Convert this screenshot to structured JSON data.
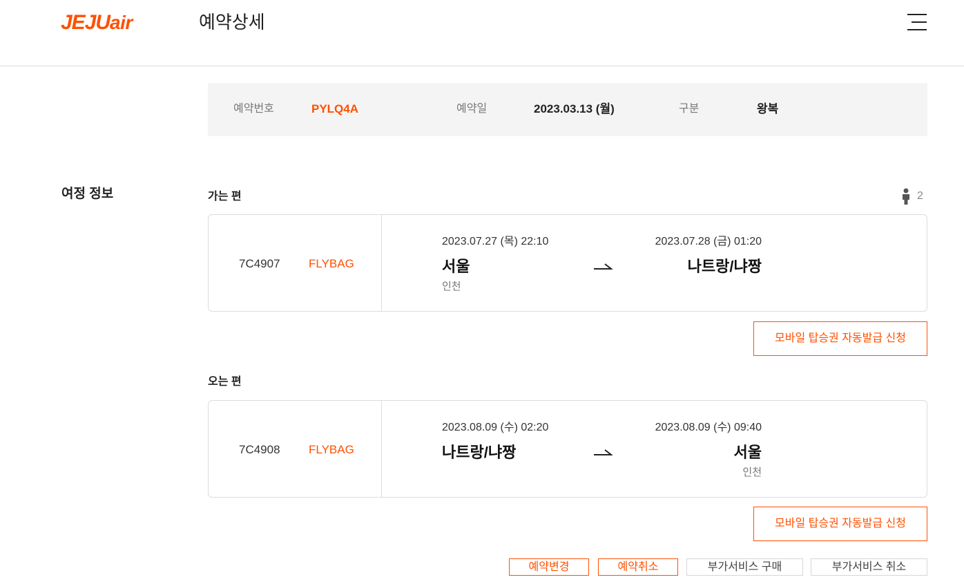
{
  "header": {
    "logo_main": "JEJU",
    "logo_suffix": "air",
    "title": "예약상세"
  },
  "summary": {
    "booking_no_label": "예약번호",
    "booking_no": "PYLQ4A",
    "booking_date_label": "예약일",
    "booking_date": "2023.03.13 (월)",
    "type_label": "구분",
    "type": "왕복"
  },
  "itinerary": {
    "section_title": "여정 정보",
    "passenger_count": "2",
    "outbound": {
      "title": "가는 편",
      "flight_no": "7C4907",
      "fare": "FLYBAG",
      "dep_time": "2023.07.27 (목) 22:10",
      "arr_time": "2023.07.28 (금) 01:20",
      "dep_city": "서울",
      "dep_airport": "인천",
      "arr_city": "나트랑/냐짱",
      "mobile_pass_label": "모바일 탑승권 자동발급 신청"
    },
    "inbound": {
      "title": "오는 편",
      "flight_no": "7C4908",
      "fare": "FLYBAG",
      "dep_time": "2023.08.09 (수) 02:20",
      "arr_time": "2023.08.09 (수) 09:40",
      "dep_city": "나트랑/냐짱",
      "arr_city": "서울",
      "arr_airport": "인천",
      "mobile_pass_label": "모바일 탑승권 자동발급 신청"
    }
  },
  "actions": {
    "change": "예약변경",
    "cancel": "예약취소",
    "buy_addon": "부가서비스 구매",
    "cancel_addon": "부가서비스 취소"
  },
  "colors": {
    "brand": "#ff5000",
    "summary_bg": "#f4f4f4"
  }
}
